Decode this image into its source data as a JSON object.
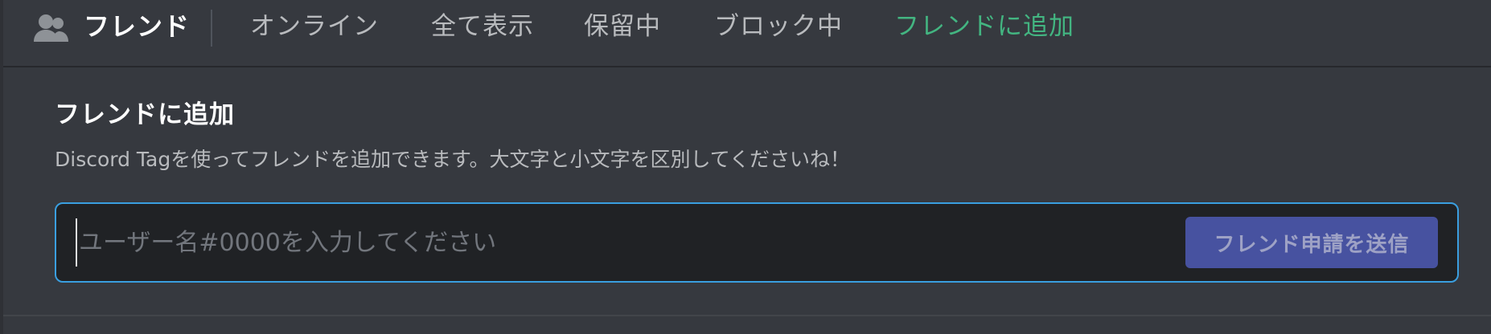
{
  "header": {
    "icon": "friends-icon",
    "title": "フレンド",
    "tabs": [
      {
        "label": "オンライン"
      },
      {
        "label": "全て表示"
      },
      {
        "label": "保留中"
      },
      {
        "label": "ブロック中"
      },
      {
        "label": "フレンドに追加"
      }
    ]
  },
  "add_friend": {
    "title": "フレンドに追加",
    "description": "Discord Tagを使ってフレンドを追加できます。大文字と小文字を区別してくださいね！",
    "input_value": "",
    "input_placeholder": "ユーザー名#0000を入力してください",
    "submit_label": "フレンド申請を送信"
  },
  "colors": {
    "background": "#36393f",
    "input_background": "#202225",
    "input_border_focus": "#3a9fe0",
    "active_tab": "#43b581",
    "button_disabled": "#4752a0"
  }
}
